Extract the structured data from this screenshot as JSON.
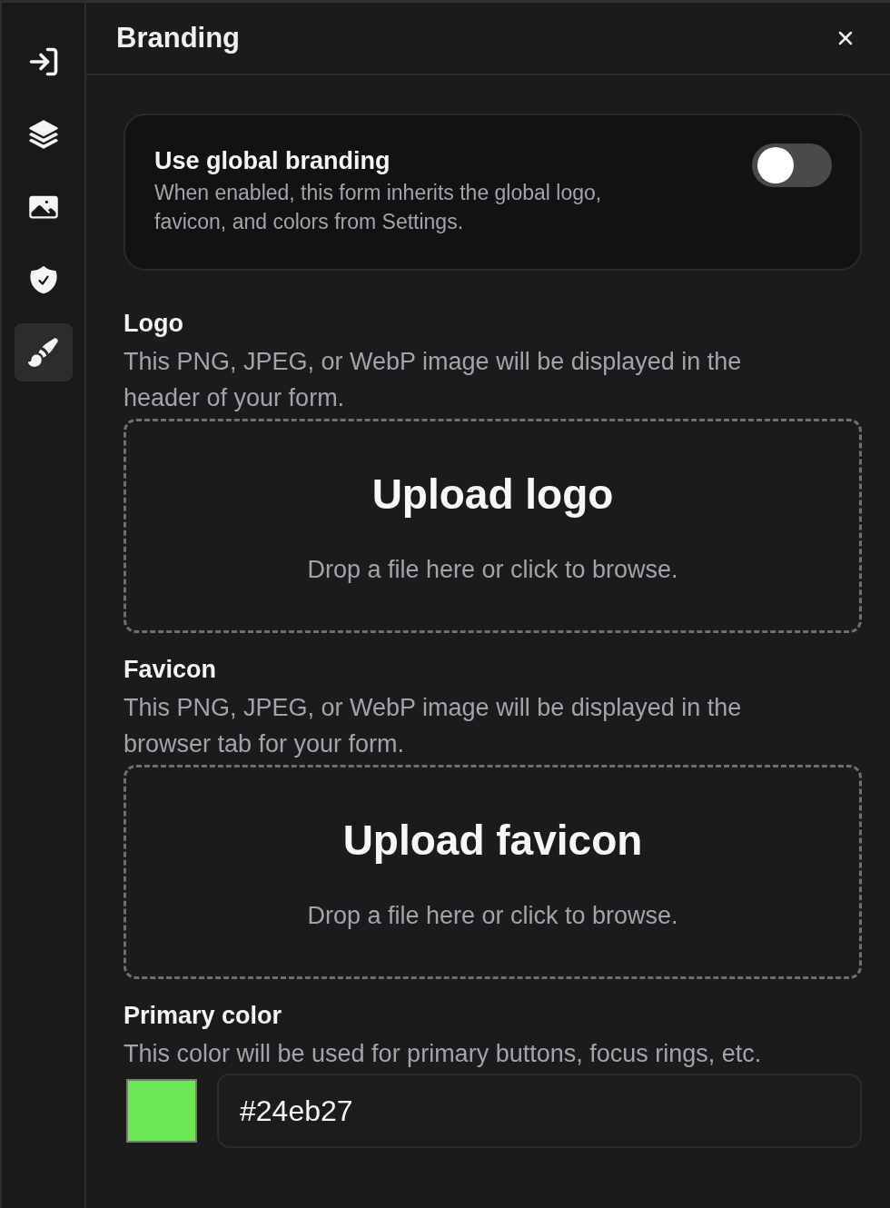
{
  "header": {
    "title": "Branding"
  },
  "sidebar": {
    "items": [
      {
        "selected": false
      },
      {
        "selected": false
      },
      {
        "selected": false
      },
      {
        "selected": false
      },
      {
        "selected": true
      }
    ]
  },
  "global_branding": {
    "title": "Use global branding",
    "description": "When enabled, this form inherits the global logo, favicon, and colors from Settings.",
    "on": false
  },
  "sections": [
    {
      "kind": "upload",
      "label": "Logo",
      "description": "This PNG, JPEG, or WebP image will be displayed in the header of your form.",
      "upload_title": "Upload logo",
      "upload_hint": "Drop a file here or click to browse."
    },
    {
      "kind": "upload",
      "label": "Favicon",
      "description": "This PNG, JPEG, or WebP image will be displayed in the browser tab for your form.",
      "upload_title": "Upload favicon",
      "upload_hint": "Drop a file here or click to browse."
    },
    {
      "kind": "color",
      "label": "Primary color",
      "description": "This color will be used for primary buttons, focus rings, etc.",
      "value": "#24eb27",
      "color": "#6de754"
    }
  ]
}
